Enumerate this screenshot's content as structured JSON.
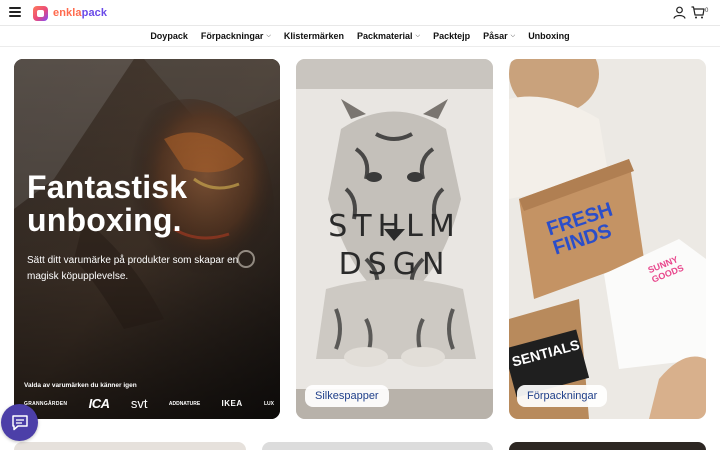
{
  "header": {
    "logo_text_a": "enkla",
    "logo_text_b": "pack",
    "cart_count": "0"
  },
  "nav": {
    "items": [
      {
        "label": "Doypack",
        "dropdown": false
      },
      {
        "label": "Förpackningar",
        "dropdown": true
      },
      {
        "label": "Klistermärken",
        "dropdown": false
      },
      {
        "label": "Packmaterial",
        "dropdown": true
      },
      {
        "label": "Packtejp",
        "dropdown": false
      },
      {
        "label": "Påsar",
        "dropdown": true
      },
      {
        "label": "Unboxing",
        "dropdown": false
      }
    ]
  },
  "hero": {
    "title_line1": "Fantastisk",
    "title_line2": "unboxing.",
    "subtitle": "Sätt ditt varumärke på produkter som skapar en magisk köpupplevelse.",
    "brands_label": "Valda av varumärken du känner igen",
    "brands": [
      "GRANNGÅRDEN",
      "ICA",
      "svt",
      "ADDNATURE",
      "IKEA",
      "LUX"
    ]
  },
  "cards": {
    "tiger_line1": "STHLM",
    "tiger_line2": "DSGN",
    "tiger_label": "Silkespapper",
    "boxes_label": "Förpackningar",
    "box_brand_1a": "FRESH",
    "box_brand_1b": "FINDS",
    "box_brand_2a": "SUNNY",
    "box_brand_2b": "GOODS",
    "box_brand_3": "SENTIALS"
  },
  "colors": {
    "accent_orange": "#ff6a4d",
    "accent_purple": "#6a4ae8",
    "chat_bg": "#4c3fa8",
    "pill_text": "#1f3f8a"
  }
}
